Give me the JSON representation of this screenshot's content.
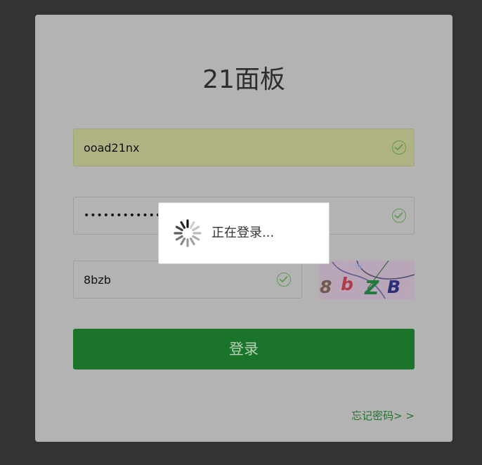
{
  "login": {
    "title": "21面板",
    "username_value": "ooad21nx",
    "password_value": "••••••••••••••",
    "captcha_value": "8bzb",
    "captcha_image_text": "8bZB",
    "login_button_label": "登录",
    "forgot_password_link": "忘记密码> >",
    "loading_text": "正在登录..."
  },
  "colors": {
    "background": "#333333",
    "card": "#b3b3b3",
    "primary_button": "#1a7429",
    "link": "#23742f",
    "valid_check": "#5f9a4e"
  },
  "icons": {
    "valid": "check-circle-icon",
    "loading": "spinner-icon"
  }
}
